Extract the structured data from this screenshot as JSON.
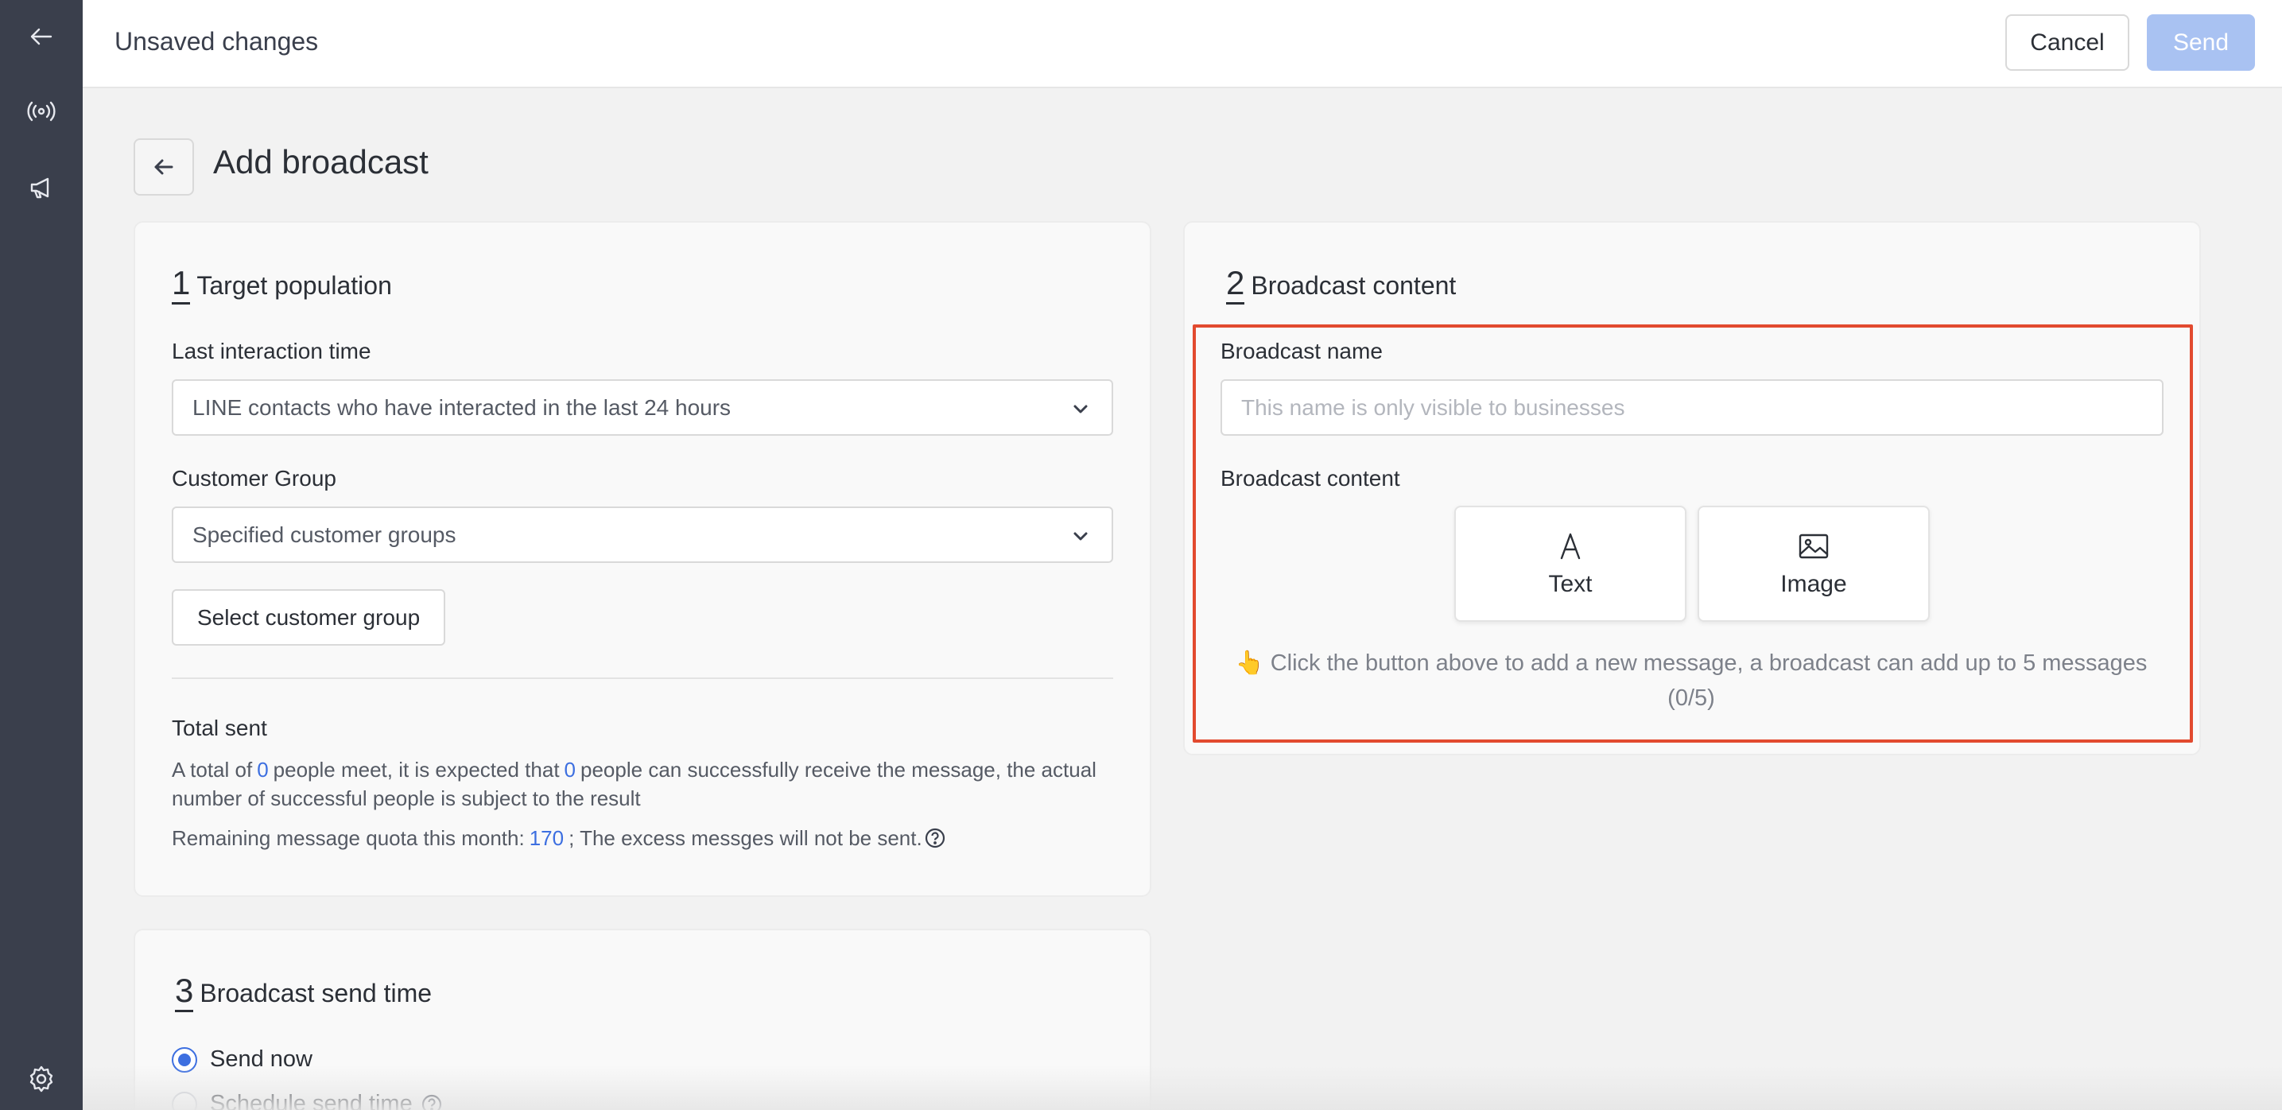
{
  "sidebar": {
    "items": [
      {
        "icon": "arrow-left-icon"
      },
      {
        "icon": "broadcast-icon"
      },
      {
        "icon": "megaphone-icon"
      },
      {
        "icon": "gear-icon"
      }
    ]
  },
  "topbar": {
    "title": "Unsaved changes",
    "cancel_label": "Cancel",
    "send_label": "Send"
  },
  "page": {
    "title": "Add broadcast"
  },
  "target": {
    "number": "1",
    "title": "Target population",
    "last_interaction_label": "Last interaction time",
    "last_interaction_value": "LINE contacts who have interacted in the last 24 hours",
    "customer_group_label": "Customer Group",
    "customer_group_value": "Specified customer groups",
    "select_group_label": "Select customer group",
    "total_sent_label": "Total sent",
    "total_text_1": "A total of",
    "total_count": "0",
    "total_text_2": "people meet, it is expected that",
    "expected_count": "0",
    "total_text_3": "people can successfully receive the message, the actual number of successful people is subject to the result",
    "quota_text": "Remaining message quota this month:",
    "quota_value": "170",
    "quota_suffix": "; The excess messges will not be sent."
  },
  "content": {
    "number": "2",
    "title": "Broadcast content",
    "name_label": "Broadcast name",
    "name_placeholder": "This name is only visible to businesses",
    "content_label": "Broadcast content",
    "tiles": [
      {
        "label": "Text",
        "icon": "text-icon"
      },
      {
        "label": "Image",
        "icon": "image-icon"
      }
    ],
    "hint": "👆 Click the button above to add a new message, a broadcast can add up to 5 messages (0/5)"
  },
  "send_time": {
    "number": "3",
    "title": "Broadcast send time",
    "options": [
      {
        "label": "Send now",
        "checked": true
      },
      {
        "label": "Schedule send time",
        "checked": false
      }
    ]
  },
  "colors": {
    "accent": "#3d6fe0",
    "highlight_border": "#e24a2f",
    "sidebar_bg": "#3a3f4c",
    "send_disabled": "#a9c2f2"
  }
}
